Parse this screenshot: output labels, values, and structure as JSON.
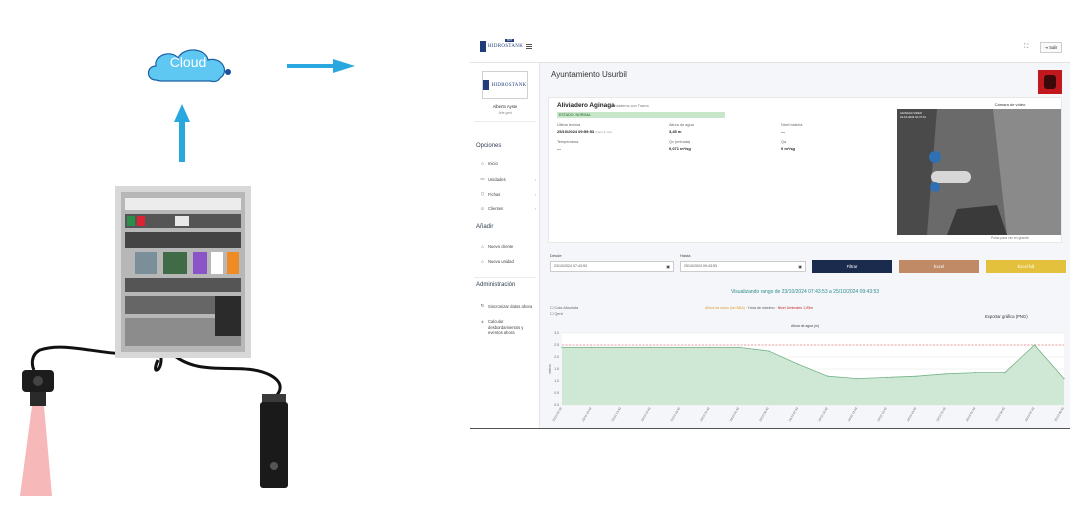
{
  "diagram": {
    "cloud_label": "Cloud",
    "colors": {
      "cloud": "#5ec8f2",
      "arrow": "#29a8e0",
      "beam": "#f4a6a6"
    }
  },
  "app": {
    "brand": "HIDROSTANK",
    "brand_badge": "BOT",
    "exit_label": "Salir",
    "user": {
      "name": "Alberto Ayste",
      "role": "Jefe gest"
    },
    "sections": {
      "options": "Opciones",
      "add": "Añadir",
      "admin": "Administración"
    },
    "nav": {
      "options": [
        {
          "label": "Inicio",
          "icon": "home-icon"
        },
        {
          "label": "Unidades",
          "icon": "monitor-icon"
        },
        {
          "label": "Fichas",
          "icon": "file-icon"
        },
        {
          "label": "Clientes",
          "icon": "users-icon"
        }
      ],
      "add": [
        {
          "label": "Nuevo cliente",
          "icon": "home-icon"
        },
        {
          "label": "Nueva unidad",
          "icon": "home-icon"
        }
      ],
      "admin": [
        {
          "label": "Sincronizar datos ahora",
          "icon": "sync-icon"
        },
        {
          "label": "Calcular desbordamientos y eventos ahora",
          "icon": "calc-icon"
        }
      ]
    },
    "page_title": "Ayuntamiento Usurbil",
    "station": {
      "name": "Aliviadero Aginaga",
      "subtitle": "Aliviaderos con Trama",
      "status": "ESTADO: NORMAL",
      "fields": [
        {
          "label": "Última lectura",
          "value": "25/10/2024 09:59:53",
          "extra": "(hace 6 min)"
        },
        {
          "label": "Altura de agua",
          "value": "3,45 m",
          "extra": ""
        },
        {
          "label": "Nivel batería",
          "value": "---",
          "extra": ""
        },
        {
          "label": "Temperatura",
          "value": "---",
          "extra": ""
        },
        {
          "label": "Qv (entrada)",
          "value": "0,071 m³/sg",
          "extra": ""
        },
        {
          "label": "Qa",
          "value": "0 m³/sg",
          "extra": ""
        }
      ],
      "camera_title": "Cámara de vídeo",
      "camera_caption": "Pulsa para ver en grande",
      "camera_overlay_1": "AGINAGA VIDEO",
      "camera_overlay_2": "24-10-2024 10:47:41"
    },
    "filters": {
      "from_label": "Desde",
      "from_value": "23/10/2024 07:43:53",
      "to_label": "Hasta",
      "to_value": "25/10/2024 09:43:53",
      "filter_btn": "Filtrar",
      "excel_btn": "Excel",
      "excel_full_btn": "Excel full"
    },
    "chart_header": {
      "title": "Visualizando rango de 23/10/2024 07:43:53 a 25/10/2024 09:43:53",
      "option_1": "Cota Absoluta",
      "option_2": "Qent",
      "legend_1": "Altura de aviso (sin BBA)",
      "legend_sep": " · ",
      "legend_2": "Hora de máximo",
      "legend_3": "Nivel Umbrales 1,95m",
      "export": "Exportar gráfica (PNG)",
      "subtitle": "Altura de agua (m)"
    },
    "colors": {
      "navy": "#1b2b4d",
      "excel": "#c08a67",
      "excel_full": "#e3c13c",
      "status_bg": "#c8e6c9",
      "area_fill": "#cfe8d5",
      "area_line": "#74b487",
      "threshold": "#d9534f"
    }
  },
  "chart_data": {
    "type": "area",
    "title": "Altura de agua (m)",
    "ylabel": "metros",
    "ylim": [
      0,
      3.0
    ],
    "y_ticks": [
      0,
      0.5,
      1.0,
      1.5,
      2.0,
      2.5,
      3.0
    ],
    "threshold": 2.5,
    "x": [
      "23/10 07:43",
      "23/10 10:43",
      "23/10 13:43",
      "23/10 16:43",
      "23/10 19:43",
      "23/10 22:43",
      "24/10 01:43",
      "24/10 04:43",
      "24/10 07:43",
      "24/10 10:43",
      "24/10 13:43",
      "24/10 16:43",
      "24/10 19:43",
      "24/10 22:43",
      "25/10 01:43",
      "25/10 04:43",
      "25/10 07:43",
      "25/10 09:43"
    ],
    "values": [
      2.4,
      2.4,
      2.4,
      2.4,
      2.4,
      2.4,
      2.4,
      2.25,
      1.7,
      1.2,
      1.1,
      1.15,
      1.2,
      1.3,
      1.35,
      1.35,
      2.5,
      1.1
    ]
  }
}
